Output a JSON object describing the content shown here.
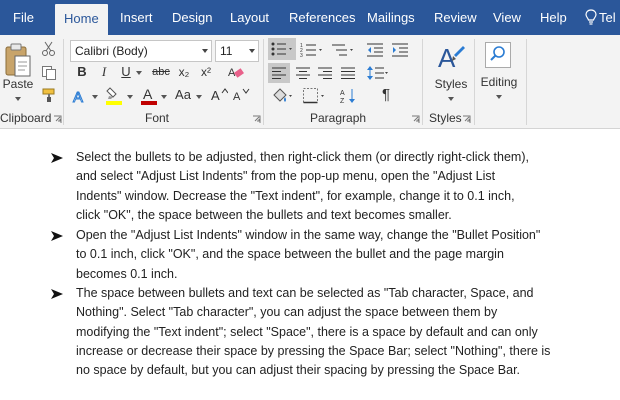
{
  "tabs": [
    "File",
    "Home",
    "Insert",
    "Design",
    "Layout",
    "References",
    "Mailings",
    "Review",
    "View",
    "Help",
    "Tel"
  ],
  "clipboard": {
    "paste_label": "Paste",
    "group_label": "Clipboard"
  },
  "font": {
    "name": "Calibri (Body)",
    "size": "11",
    "group_label": "Font",
    "bold": "B",
    "italic": "I",
    "underline": "U",
    "strike": "abc",
    "sub": "x₂",
    "sup": "x²",
    "case": "Aa"
  },
  "paragraph": {
    "group_label": "Paragraph",
    "pilcrow": "¶"
  },
  "styles": {
    "label": "Styles",
    "group_label": "Styles"
  },
  "editing": {
    "label": "Editing"
  },
  "colors": {
    "ribbon_blue": "#2b579a",
    "highlight": "#ffff00",
    "font_color": "#c00000"
  },
  "document": {
    "bullets": [
      {
        "lines": [
          "Select the bullets to be adjusted, then right-click them (or directly right-click them),",
          "and select \"Adjust List Indents\" from the pop-up menu, open the \"Adjust List",
          "Indents\" window. Decrease the \"Text indent\", for example, change it to 0.1 inch,",
          "click \"OK\", the space between the bullets and text becomes smaller."
        ]
      },
      {
        "lines": [
          "Open the \"Adjust List Indents\" window in the same way, change the \"Bullet Position\"",
          "to 0.1 inch, click \"OK\", and the space between the bullet and the page margin",
          "becomes 0.1 inch."
        ]
      },
      {
        "lines": [
          "The space between bullets and text can be selected as \"Tab character, Space, and",
          "Nothing\". Select \"Tab character\", you can adjust the space between them by",
          "modifying the \"Text indent\"; select \"Space\", there is a space by default and can only",
          "increase or decrease their space by pressing the Space Bar; select \"Nothing\", there is",
          "no space by default, but you can adjust their spacing by pressing the Space Bar."
        ]
      }
    ]
  }
}
